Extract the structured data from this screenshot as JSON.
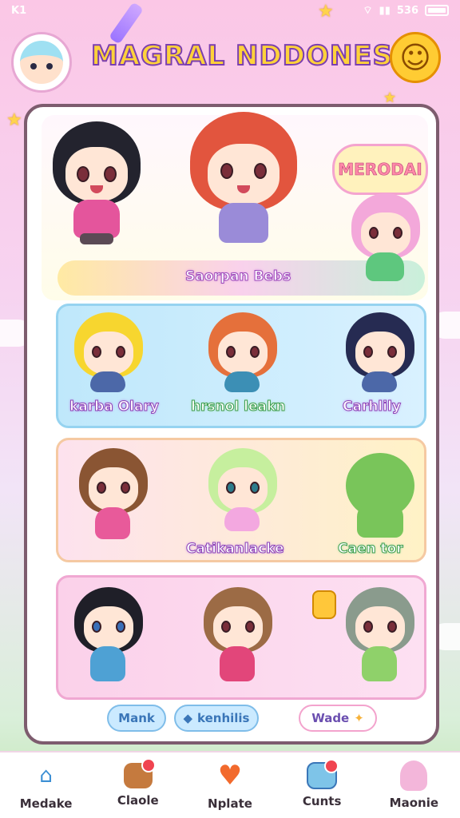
{
  "status_bar": {
    "left_text": "K1",
    "right_text": "536"
  },
  "header": {
    "title": "MAGRAL NDDONESI!",
    "left_icon": "avatar-icon",
    "right_icon": "smiley-icon"
  },
  "hero": {
    "bubble_text": "MERODAI",
    "caption": "Saorpan Bebs"
  },
  "row1": {
    "labels": [
      "karba Olary",
      "hrsnol leakn",
      "Carhlily"
    ]
  },
  "row2": {
    "labels": [
      "Catikanlacke",
      "Caen tor"
    ]
  },
  "pills": {
    "mark": "Mank",
    "tab2": "kenhilis",
    "wade": "Wade"
  },
  "nav": {
    "items": [
      {
        "label": "Medake",
        "icon": "home-icon"
      },
      {
        "label": "Claole",
        "icon": "chest-icon"
      },
      {
        "label": "Nplate",
        "icon": "heart-icon"
      },
      {
        "label": "Cunts",
        "icon": "map-icon"
      },
      {
        "label": "Maonie",
        "icon": "ghost-icon"
      }
    ]
  },
  "colors": {
    "accent": "#ffd23a",
    "outline": "#7b3fb0",
    "card_border": "#7d5c6e"
  }
}
